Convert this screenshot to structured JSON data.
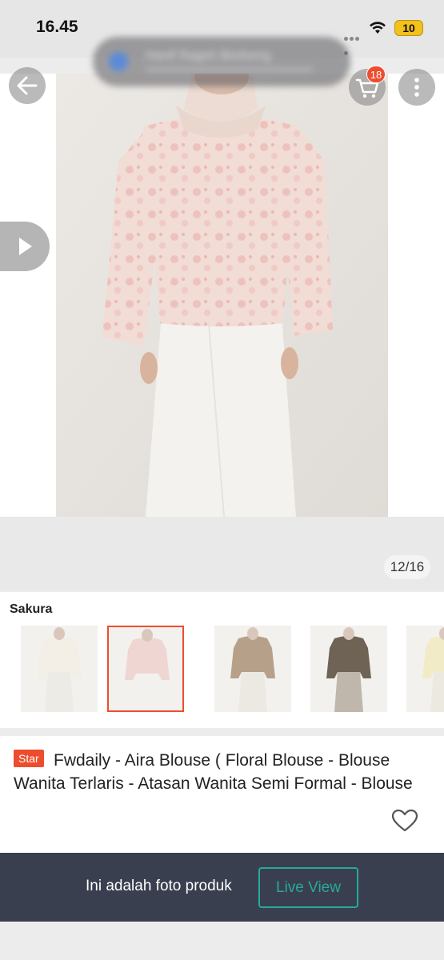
{
  "status_bar": {
    "time": "16.45",
    "battery": "10"
  },
  "notification": {
    "text": "Hanif Rageh Birdseng"
  },
  "header": {
    "back_icon": "arrow-left-icon",
    "cart_icon": "cart-icon",
    "cart_count": "18",
    "more_icon": "more-vertical-icon"
  },
  "gallery": {
    "counter": "12/16",
    "video_icon": "play-icon"
  },
  "variation": {
    "label": "Sakura",
    "thumbnails": [
      {
        "name": "cream",
        "top": "#f3efe6",
        "skirt": "#ecebe6",
        "selected": false
      },
      {
        "name": "sakura",
        "top": "#efd6d2",
        "skirt": "#f3f1ed",
        "selected": true
      },
      {
        "name": "mocca",
        "top": "#b7a089",
        "skirt": "#ece9e3",
        "selected": false
      },
      {
        "name": "brown",
        "top": "#6f6355",
        "skirt": "#bfb7ac",
        "selected": false
      },
      {
        "name": "yellow",
        "top": "#f1ebc8",
        "skirt": "#ece9e1",
        "selected": false
      }
    ]
  },
  "product": {
    "badge": "Star",
    "title": "Fwdaily - Aira Blouse ( Floral Blouse - Blouse Wanita Terlaris - Atasan Wanita Semi Formal - Blouse",
    "favorite_icon": "heart-icon"
  },
  "banner": {
    "text": "Ini adalah foto produk",
    "button": "Live View"
  },
  "colors": {
    "accent": "#ee4d2d",
    "teal": "#26aa99",
    "banner_bg": "#3a3f50"
  }
}
